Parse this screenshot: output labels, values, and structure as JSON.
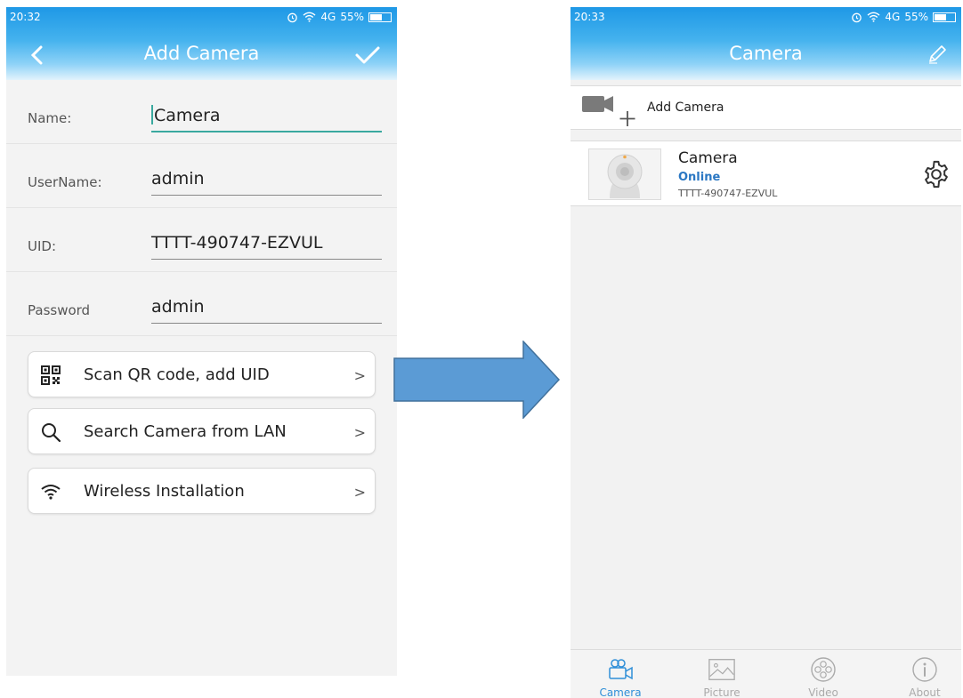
{
  "left_screen": {
    "status_time": "20:32",
    "status_signal": "4G",
    "status_battery": "55%",
    "title": "Add Camera",
    "fields": [
      {
        "label": "Name:",
        "value": "Camera"
      },
      {
        "label": "UserName:",
        "value": "admin"
      },
      {
        "label": "UID:",
        "value": "TTTT-490747-EZVUL"
      },
      {
        "label": "Password",
        "value": "admin"
      }
    ],
    "options": [
      {
        "label": "Scan QR code, add UID",
        "icon": "qr-code-icon"
      },
      {
        "label": "Search Camera from LAN",
        "icon": "search-icon"
      },
      {
        "label": "Wireless Installation",
        "icon": "wifi-icon"
      }
    ],
    "chevron": ">"
  },
  "right_screen": {
    "status_time": "20:33",
    "status_signal": "4G",
    "status_battery": "55%",
    "title": "Camera",
    "add_label": "Add Camera",
    "camera": {
      "name": "Camera",
      "status": "Online",
      "uid": "TTTT-490747-EZVUL"
    },
    "tabs": [
      {
        "label": "Camera",
        "icon": "camera-tab-icon"
      },
      {
        "label": "Picture",
        "icon": "picture-tab-icon"
      },
      {
        "label": "Video",
        "icon": "video-tab-icon"
      },
      {
        "label": "About",
        "icon": "about-tab-icon"
      }
    ]
  },
  "colors": {
    "header_blue": "#1e98e6",
    "online_blue": "#2a77c3",
    "arrow_blue": "#5b9bd5",
    "active_underline": "#3aa99f"
  }
}
